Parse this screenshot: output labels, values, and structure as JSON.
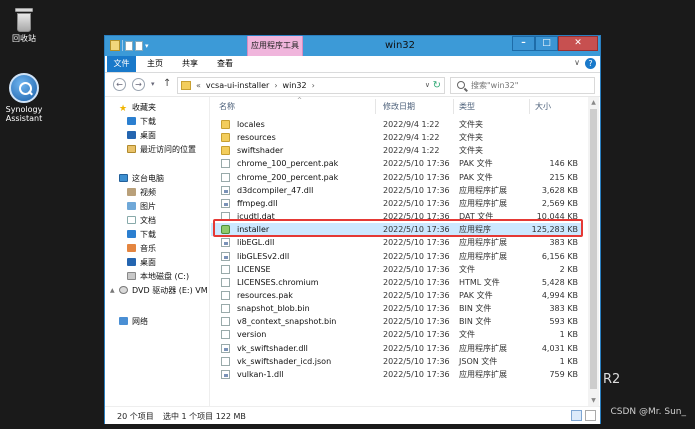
{
  "desktop": {
    "recycle_bin": "回收站",
    "synology_line1": "Synology",
    "synology_line2": "Assistant",
    "bg_text": "R2",
    "watermark": "CSDN @Mr. Sun_"
  },
  "window": {
    "title": "win32",
    "context_tab": "应用程序工具",
    "ribbon_tabs": {
      "file": "文件",
      "home": "主页",
      "share": "共享",
      "view": "查看"
    },
    "ribbon_expand": "∨",
    "help": "?",
    "min": "–",
    "max": "□",
    "close": "✕"
  },
  "address": {
    "back": "←",
    "forward": "→",
    "up": "↑",
    "lead": "«",
    "crumbs": [
      "vcsa-ui-installer",
      "win32"
    ],
    "chev": "›",
    "search_placeholder": "搜索\"win32\"",
    "dropdown": "∨",
    "refresh": "↻"
  },
  "nav": {
    "favorites": "收藏夹",
    "downloads": "下载",
    "desktop": "桌面",
    "recent": "最近访问的位置",
    "this_pc": "这台电脑",
    "videos": "视频",
    "pictures": "图片",
    "documents": "文档",
    "downloads2": "下载",
    "music": "音乐",
    "desktop2": "桌面",
    "local_disk": "本地磁盘 (C:)",
    "dvd": "DVD 驱动器 (E:) VM",
    "network": "网络",
    "star": "★",
    "expander": "▲"
  },
  "columns": {
    "name": "名称",
    "date": "修改日期",
    "type": "类型",
    "size": "大小",
    "sort": "^"
  },
  "files": [
    {
      "name": "locales",
      "date": "2022/9/4 1:22",
      "type": "文件夹",
      "size": "",
      "icon": "folder"
    },
    {
      "name": "resources",
      "date": "2022/9/4 1:22",
      "type": "文件夹",
      "size": "",
      "icon": "folder"
    },
    {
      "name": "swiftshader",
      "date": "2022/9/4 1:22",
      "type": "文件夹",
      "size": "",
      "icon": "folder"
    },
    {
      "name": "chrome_100_percent.pak",
      "date": "2022/5/10 17:36",
      "type": "PAK 文件",
      "size": "146 KB",
      "icon": "file"
    },
    {
      "name": "chrome_200_percent.pak",
      "date": "2022/5/10 17:36",
      "type": "PAK 文件",
      "size": "215 KB",
      "icon": "file"
    },
    {
      "name": "d3dcompiler_47.dll",
      "date": "2022/5/10 17:36",
      "type": "应用程序扩展",
      "size": "3,628 KB",
      "icon": "dll"
    },
    {
      "name": "ffmpeg.dll",
      "date": "2022/5/10 17:36",
      "type": "应用程序扩展",
      "size": "2,569 KB",
      "icon": "dll"
    },
    {
      "name": "icudtl.dat",
      "date": "2022/5/10 17:36",
      "type": "DAT 文件",
      "size": "10,044 KB",
      "icon": "file"
    },
    {
      "name": "installer",
      "date": "2022/5/10 17:36",
      "type": "应用程序",
      "size": "125,283 KB",
      "icon": "exe"
    },
    {
      "name": "libEGL.dll",
      "date": "2022/5/10 17:36",
      "type": "应用程序扩展",
      "size": "383 KB",
      "icon": "dll"
    },
    {
      "name": "libGLESv2.dll",
      "date": "2022/5/10 17:36",
      "type": "应用程序扩展",
      "size": "6,156 KB",
      "icon": "dll"
    },
    {
      "name": "LICENSE",
      "date": "2022/5/10 17:36",
      "type": "文件",
      "size": "2 KB",
      "icon": "file"
    },
    {
      "name": "LICENSES.chromium",
      "date": "2022/5/10 17:36",
      "type": "HTML 文件",
      "size": "5,428 KB",
      "icon": "file"
    },
    {
      "name": "resources.pak",
      "date": "2022/5/10 17:36",
      "type": "PAK 文件",
      "size": "4,994 KB",
      "icon": "file"
    },
    {
      "name": "snapshot_blob.bin",
      "date": "2022/5/10 17:36",
      "type": "BIN 文件",
      "size": "383 KB",
      "icon": "file"
    },
    {
      "name": "v8_context_snapshot.bin",
      "date": "2022/5/10 17:36",
      "type": "BIN 文件",
      "size": "593 KB",
      "icon": "file"
    },
    {
      "name": "version",
      "date": "2022/5/10 17:36",
      "type": "文件",
      "size": "1 KB",
      "icon": "file"
    },
    {
      "name": "vk_swiftshader.dll",
      "date": "2022/5/10 17:36",
      "type": "应用程序扩展",
      "size": "4,031 KB",
      "icon": "dll"
    },
    {
      "name": "vk_swiftshader_icd.json",
      "date": "2022/5/10 17:36",
      "type": "JSON 文件",
      "size": "1 KB",
      "icon": "file"
    },
    {
      "name": "vulkan-1.dll",
      "date": "2022/5/10 17:36",
      "type": "应用程序扩展",
      "size": "759 KB",
      "icon": "dll"
    }
  ],
  "status": {
    "count": "20 个项目",
    "selected": "选中 1 个项目  122 MB"
  },
  "scroll": {
    "up": "▲",
    "down": "▼"
  },
  "colors": {
    "accent": "#1979ca",
    "highlight": "#e53935",
    "selected_row": "#cce8ff"
  }
}
